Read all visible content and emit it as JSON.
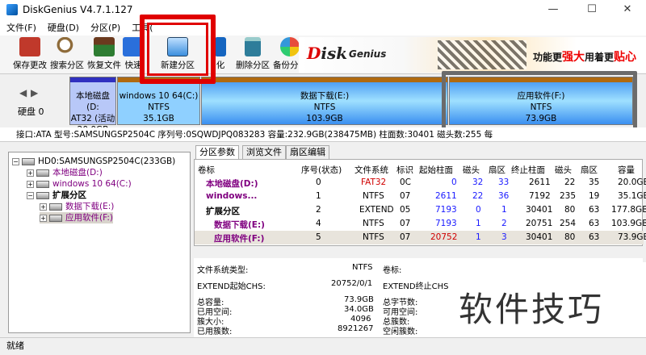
{
  "window": {
    "title": "DiskGenius V4.7.1.127",
    "min": "—",
    "max": "☐",
    "close": "✕"
  },
  "menu": [
    "文件(F)",
    "硬盘(D)",
    "分区(P)",
    "工具("
  ],
  "toolbar": [
    {
      "label": "保存更改",
      "icon": "save-icon",
      "color": "#c0392b"
    },
    {
      "label": "搜索分区",
      "icon": "search-icon",
      "color": "#8e6b3a"
    },
    {
      "label": "恢复文件",
      "icon": "recover-icon",
      "color": "#2e7d32"
    },
    {
      "label": "快速",
      "icon": "quick-partition-icon",
      "color": "#2a6fdb"
    },
    {
      "label": "新建分区",
      "icon": "new-partition-icon",
      "color": "#3b8ede"
    },
    {
      "label": "化",
      "icon": "format-icon",
      "color": "#1565c0"
    },
    {
      "label": "删除分区",
      "icon": "delete-icon",
      "color": "#2e7d9a"
    },
    {
      "label": "备份分区",
      "icon": "backup-icon",
      "color": "#d35400"
    }
  ],
  "banner": {
    "logo_d": "D",
    "logo_rest": "isk",
    "sub": "Genius",
    "promo1": "功能更",
    "promo2": "强大",
    "promo3": "用着更",
    "promo4": "贴心"
  },
  "disk": {
    "label": "硬盘 0",
    "partitions": [
      {
        "name": "本地磁盘(D:",
        "fs": "AT32 (活动",
        "size": "20.0GB",
        "color": "#b8c8f8",
        "top": "#3030c0"
      },
      {
        "name": "windows 10  64(C:)",
        "fs": "NTFS",
        "size": "35.1GB",
        "color": "#8fd0ff",
        "top": "#b06a10"
      },
      {
        "name": "数据下载(E:)",
        "fs": "NTFS",
        "size": "103.9GB",
        "color": "#5ab0ff",
        "top": "#b06a10"
      },
      {
        "name": "应用软件(F:)",
        "fs": "NTFS",
        "size": "73.9GB",
        "color": "#4aa8ff",
        "top": "#b06a10"
      }
    ]
  },
  "infobar": "接口:ATA  型号:SAMSUNGSP2504C  序列号:0SQWDJPQ083283  容量:232.9GB(238475MB)  柱面数:30401  磁头数:255  每",
  "tree": {
    "root": "HD0:SAMSUNGSP2504C(233GB)",
    "items": [
      {
        "label": "本地磁盘(D:)",
        "cls": "purple"
      },
      {
        "label": "windows 10  64(C:)",
        "cls": "purple"
      },
      {
        "label": "扩展分区",
        "cls": "bold"
      },
      {
        "label": "数据下载(E:)",
        "cls": "purple"
      },
      {
        "label": "应用软件(F:)",
        "cls": "purple"
      }
    ]
  },
  "tabs": [
    "分区参数",
    "浏览文件",
    "扇区编辑"
  ],
  "table": {
    "headers": [
      "卷标",
      "序号(状态)",
      "文件系统",
      "标识",
      "起始柱面",
      "磁头",
      "扇区",
      "终止柱面",
      "磁头",
      "扇区",
      "容量"
    ],
    "rows": [
      {
        "c": [
          "本地磁盘(D:)",
          "0",
          "FAT32",
          "0C",
          "0",
          "32",
          "33",
          "2611",
          "22",
          "35",
          "20.0GB"
        ]
      },
      {
        "c": [
          "windows...",
          "1",
          "NTFS",
          "07",
          "2611",
          "22",
          "36",
          "7192",
          "235",
          "19",
          "35.1GB"
        ]
      },
      {
        "c": [
          "扩展分区",
          "2",
          "EXTEND",
          "05",
          "7193",
          "0",
          "1",
          "30401",
          "80",
          "63",
          "177.8GB"
        ]
      },
      {
        "c": [
          "数据下载(E:)",
          "4",
          "NTFS",
          "07",
          "7193",
          "1",
          "2",
          "20751",
          "254",
          "63",
          "103.9GB"
        ]
      },
      {
        "c": [
          "应用软件(F:)",
          "5",
          "NTFS",
          "07",
          "20752",
          "1",
          "3",
          "30401",
          "80",
          "63",
          "73.9GB"
        ]
      }
    ]
  },
  "details": {
    "fs_type_label": "文件系统类型:",
    "fs_type": "NTFS",
    "vol_label": "卷标:",
    "ext_start_label": "EXTEND起始CHS:",
    "ext_start": "20752/0/1",
    "ext_end_label": "EXTEND终止CHS:",
    "rows": [
      {
        "l": "总容量:",
        "v": "73.9GB",
        "r": "总字节数:"
      },
      {
        "l": "已用空间:",
        "v": "34.0GB",
        "r": "可用空间:"
      },
      {
        "l": "簇大小:",
        "v": "4096",
        "r": "总簇数:"
      },
      {
        "l": "已用簇数:",
        "v": "8921267",
        "r": "空闲簇数:"
      }
    ]
  },
  "watermark": "软件技巧",
  "status": "就绪"
}
